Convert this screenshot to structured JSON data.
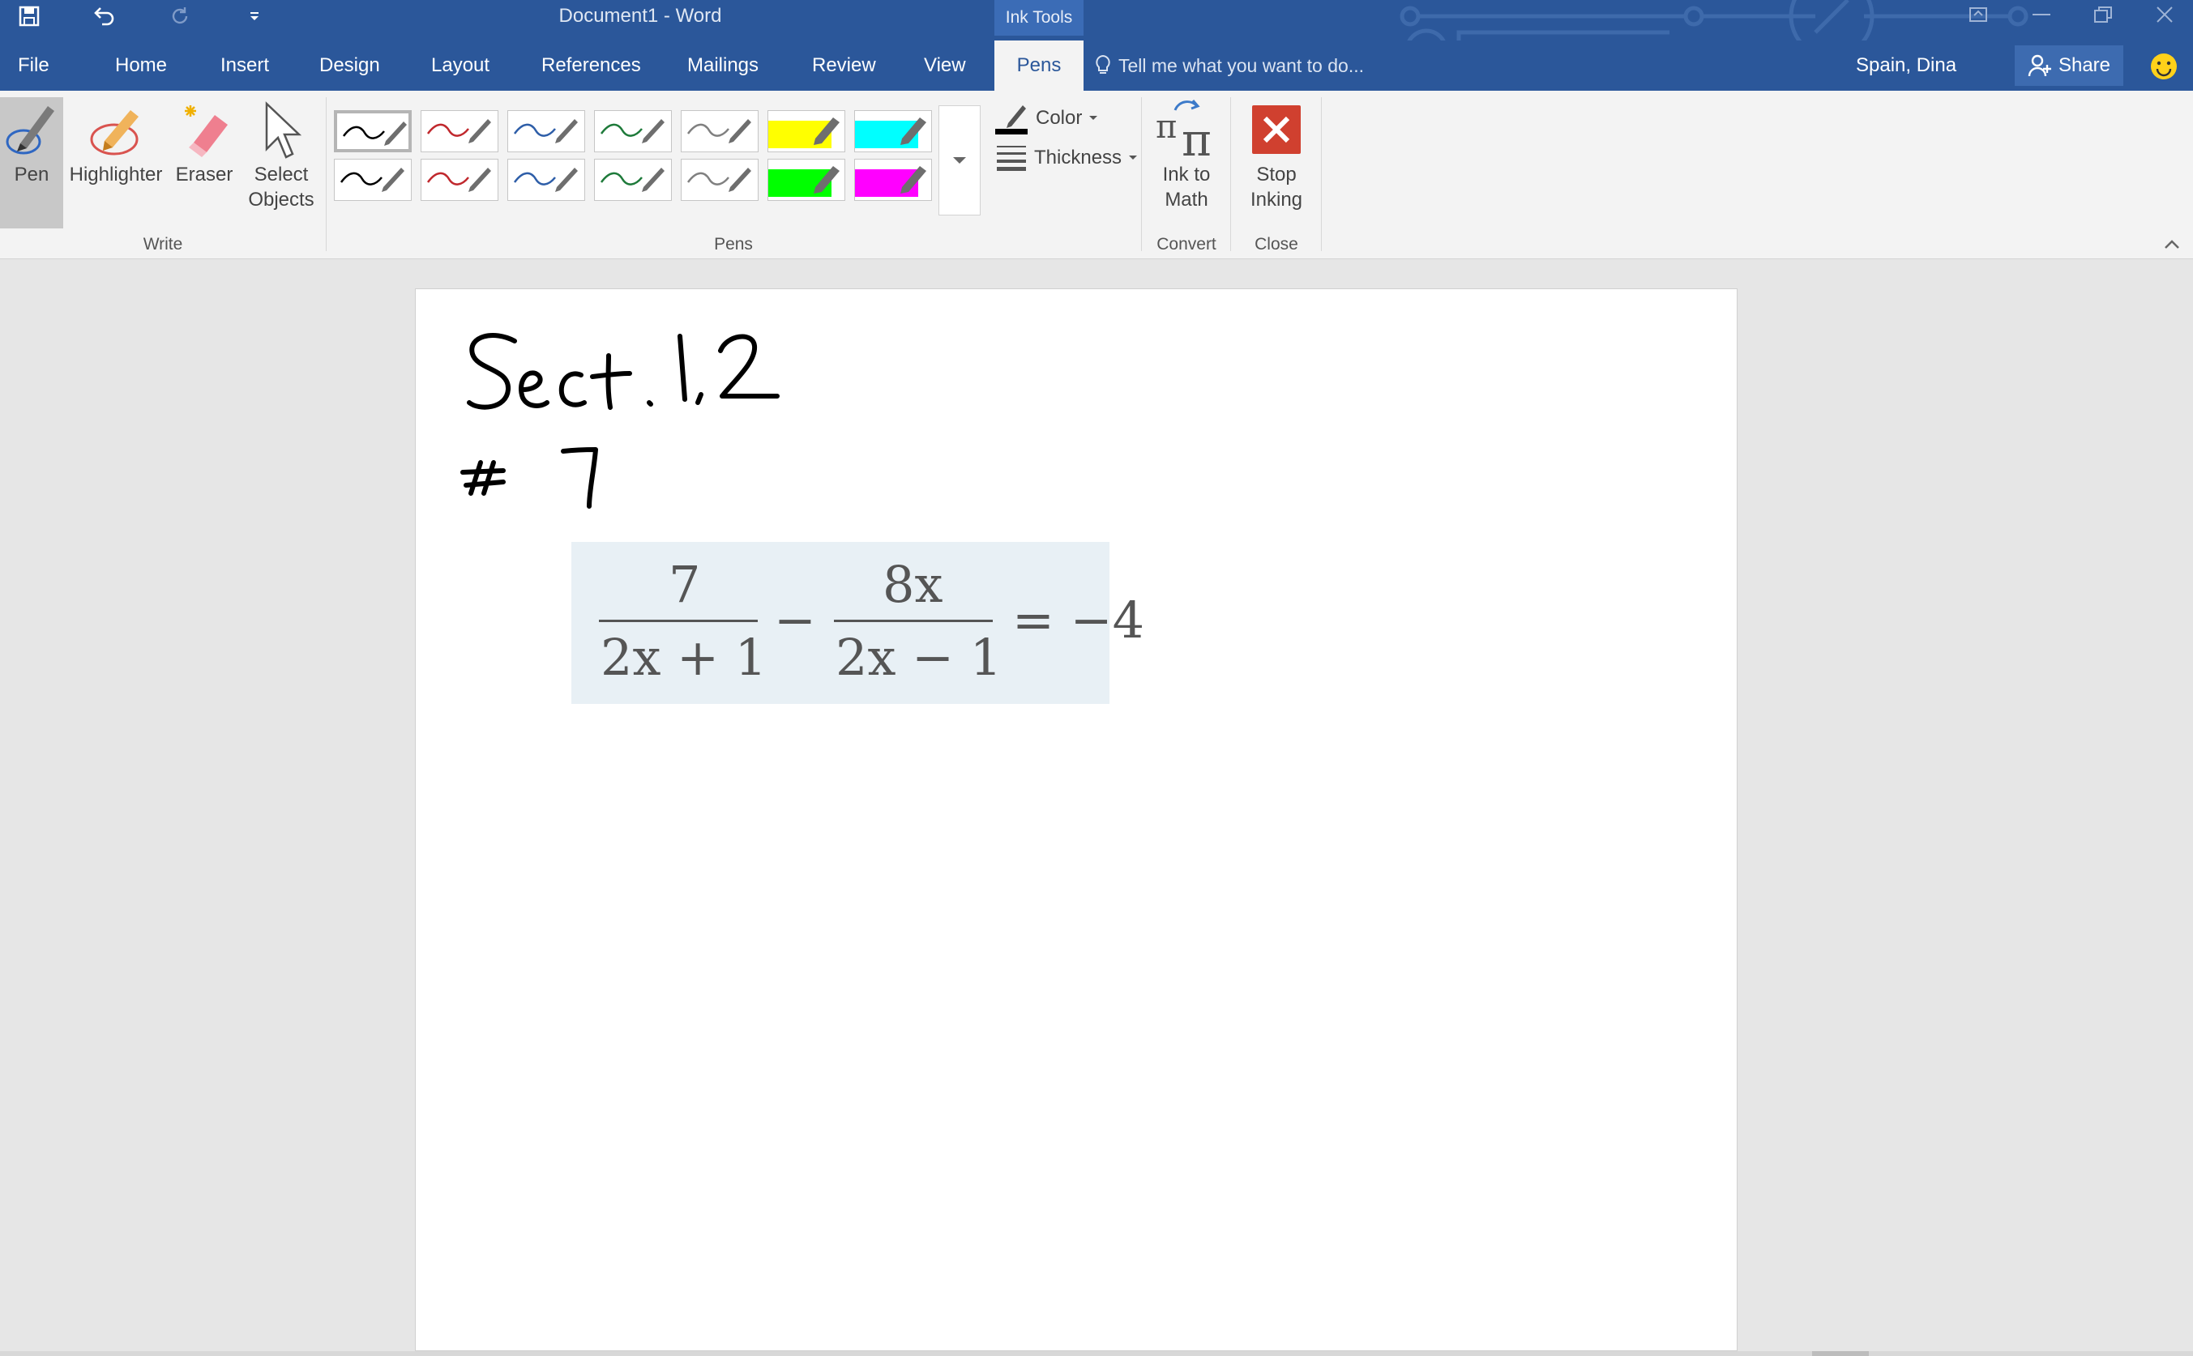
{
  "window": {
    "title": "Document1 - Word",
    "context_tab_group": "Ink Tools",
    "accent_color": "#2b579a"
  },
  "quick_access": {
    "save_icon": "save-icon",
    "undo_icon": "undo-icon",
    "redo_icon": "redo-icon",
    "customize_icon": "customize-qat-icon"
  },
  "tabs": [
    {
      "label": "File"
    },
    {
      "label": "Home"
    },
    {
      "label": "Insert"
    },
    {
      "label": "Design"
    },
    {
      "label": "Layout"
    },
    {
      "label": "References"
    },
    {
      "label": "Mailings"
    },
    {
      "label": "Review"
    },
    {
      "label": "View"
    },
    {
      "label": "Pens",
      "active": true
    }
  ],
  "tell_me": {
    "placeholder": "Tell me what you want to do..."
  },
  "user": {
    "name": "Spain, Dina"
  },
  "share": {
    "label": "Share"
  },
  "ribbon": {
    "write_group": {
      "label": "Write",
      "pen": "Pen",
      "highlighter": "Highlighter",
      "eraser": "Eraser",
      "select_line1": "Select",
      "select_line2": "Objects"
    },
    "pens_group": {
      "label": "Pens",
      "swatches_row1": [
        {
          "kind": "pen",
          "color": "#000000",
          "selected": true
        },
        {
          "kind": "pen",
          "color": "#c0282d"
        },
        {
          "kind": "pen",
          "color": "#2e5ea8"
        },
        {
          "kind": "pen",
          "color": "#1e7a3a"
        },
        {
          "kind": "pen",
          "color": "#808080"
        },
        {
          "kind": "highlighter",
          "color": "#ffff00"
        },
        {
          "kind": "highlighter",
          "color": "#00ffff"
        }
      ],
      "swatches_row2": [
        {
          "kind": "pen",
          "color": "#000000"
        },
        {
          "kind": "pen",
          "color": "#c0282d"
        },
        {
          "kind": "pen",
          "color": "#2e5ea8"
        },
        {
          "kind": "pen",
          "color": "#1e7a3a"
        },
        {
          "kind": "pen",
          "color": "#808080"
        },
        {
          "kind": "highlighter",
          "color": "#00ff00"
        },
        {
          "kind": "highlighter",
          "color": "#ff00ff"
        }
      ],
      "color_label": "Color",
      "thickness_label": "Thickness"
    },
    "convert_group": {
      "label": "Convert",
      "ink_to_math_line1": "Ink to",
      "ink_to_math_line2": "Math"
    },
    "close_group": {
      "label": "Close",
      "stop_line1": "Stop",
      "stop_line2": "Inking"
    }
  },
  "document": {
    "handwriting_line1": "Sect. 1.2",
    "handwriting_line2": "#7",
    "equation": {
      "frac1_numerator": "7",
      "frac1_denominator": "2x + 1",
      "operator": "−",
      "frac2_numerator": "8x",
      "frac2_denominator": "2x − 1",
      "rhs": "= −4"
    }
  }
}
